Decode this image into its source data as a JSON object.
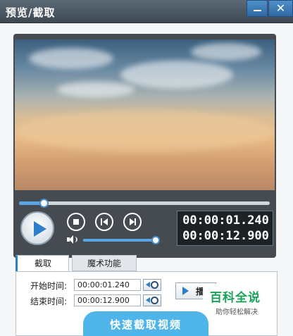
{
  "window": {
    "title": "预览/截取",
    "minimize_glyph": "—",
    "close_glyph": "✕"
  },
  "player": {
    "progress": 0.097,
    "volume": 0.95,
    "current_time": "00:00:01.240",
    "total_time": "00:00:12.900",
    "icons": [
      "play-icon",
      "stop-icon",
      "previous-icon",
      "next-icon",
      "volume-icon"
    ]
  },
  "tabs": [
    {
      "label": "截取",
      "active": true
    },
    {
      "label": "魔术功能",
      "active": false
    }
  ],
  "clip": {
    "start_label": "开始时间:",
    "start_value": "00:00:01.240",
    "end_label": "结束时间:",
    "end_value": "00:00:12.900",
    "preview_button_label": "播"
  },
  "watermark": {
    "main": "百科全说",
    "sub": "助你轻松解决"
  },
  "banner": {
    "text": "快速截取视频"
  },
  "colors": {
    "accent": "#2d7fc9",
    "titlebar": "#4a5560",
    "banner": "#4fb5e8",
    "watermark_green": "#19a35a"
  }
}
